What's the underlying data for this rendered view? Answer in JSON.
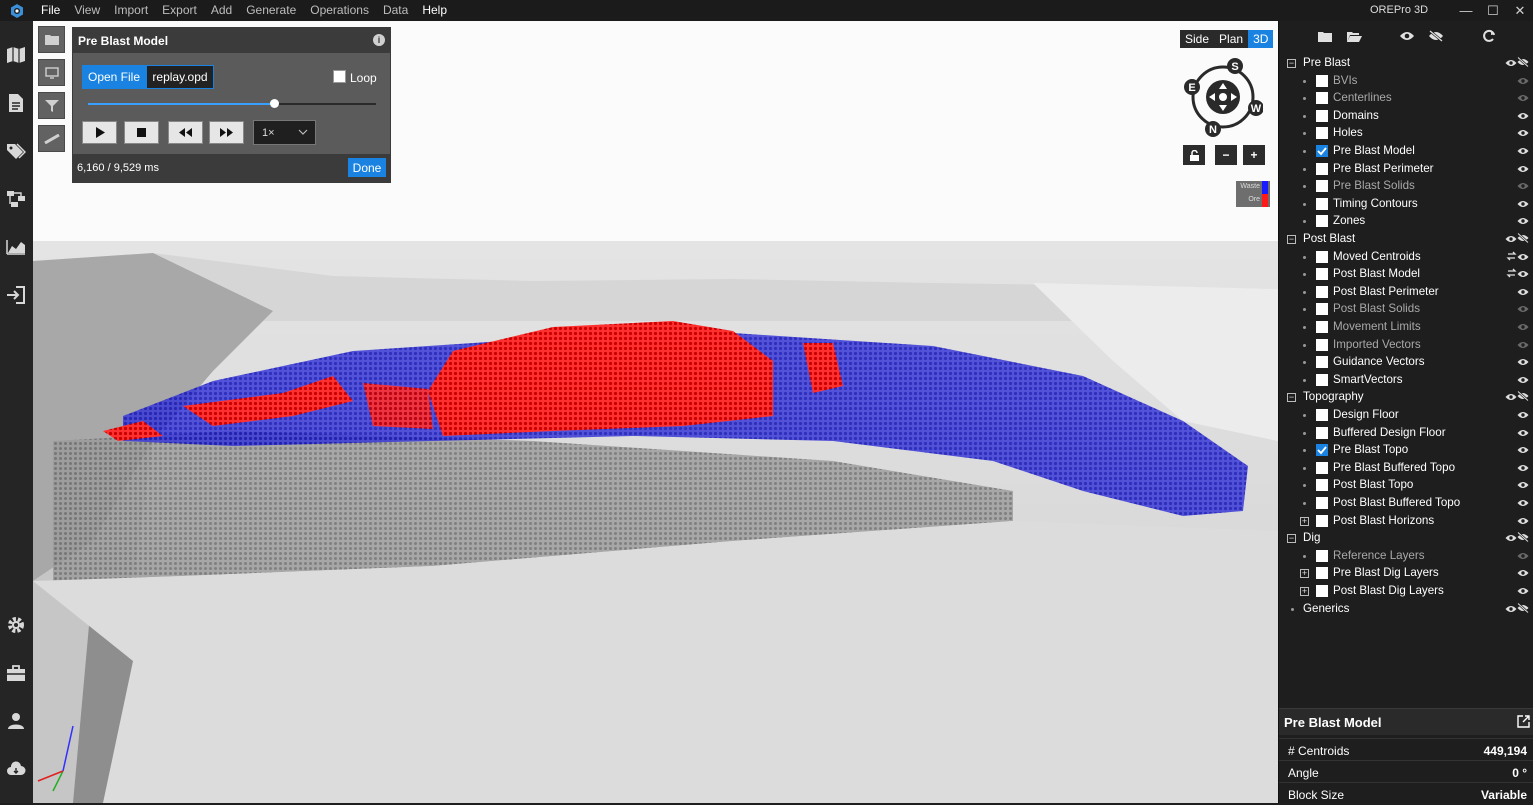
{
  "menu": [
    "File",
    "View",
    "Import",
    "Export",
    "Add",
    "Generate",
    "Operations",
    "Data",
    "Help"
  ],
  "app_title": "OREPro 3D",
  "left_rail_icons": [
    "map-icon",
    "document-icon",
    "tag-icon",
    "flow-icon",
    "chart-icon",
    "import-icon",
    "settings-icon",
    "toolbox-icon",
    "user-icon",
    "cloud-icon"
  ],
  "replay": {
    "title": "Pre Blast Model",
    "open_file_label": "Open File",
    "file_name": "replay.opd",
    "loop_label": "Loop",
    "loop_checked": false,
    "progress_fraction": 0.646,
    "speed": "1×",
    "time_readout": "6,160 / 9,529 ms",
    "done_label": "Done"
  },
  "view_toggle": {
    "options": [
      "Side",
      "Plan",
      "3D"
    ],
    "active": "3D"
  },
  "compass": {
    "labels": [
      "S",
      "E",
      "W",
      "N"
    ]
  },
  "legend": {
    "items": [
      {
        "label": "Waste",
        "color": "#1a1aff"
      },
      {
        "label": "Ore",
        "color": "#ff1a1a"
      }
    ]
  },
  "tree": [
    {
      "label": "Pre Blast",
      "level": 0,
      "expanded": true,
      "eye": "both"
    },
    {
      "label": "BVIs",
      "level": 1,
      "checked": false,
      "dim": true,
      "eye": "dim"
    },
    {
      "label": "Centerlines",
      "level": 1,
      "checked": false,
      "dim": true,
      "eye": "dim"
    },
    {
      "label": "Domains",
      "level": 1,
      "checked": false,
      "dim": false,
      "eye": "on"
    },
    {
      "label": "Holes",
      "level": 1,
      "checked": false,
      "dim": false,
      "eye": "on"
    },
    {
      "label": "Pre Blast Model",
      "level": 1,
      "checked": true,
      "dim": false,
      "eye": "on"
    },
    {
      "label": "Pre Blast Perimeter",
      "level": 1,
      "checked": false,
      "dim": false,
      "eye": "on"
    },
    {
      "label": "Pre Blast Solids",
      "level": 1,
      "checked": false,
      "dim": true,
      "eye": "dim"
    },
    {
      "label": "Timing Contours",
      "level": 1,
      "checked": false,
      "dim": false,
      "eye": "on"
    },
    {
      "label": "Zones",
      "level": 1,
      "checked": false,
      "dim": false,
      "eye": "on"
    },
    {
      "label": "Post Blast",
      "level": 0,
      "expanded": true,
      "eye": "both"
    },
    {
      "label": "Moved Centroids",
      "level": 1,
      "checked": false,
      "dim": false,
      "eye": "on",
      "extra": true
    },
    {
      "label": "Post Blast Model",
      "level": 1,
      "checked": false,
      "dim": false,
      "eye": "on",
      "extra": true
    },
    {
      "label": "Post Blast Perimeter",
      "level": 1,
      "checked": false,
      "dim": false,
      "eye": "on"
    },
    {
      "label": "Post Blast Solids",
      "level": 1,
      "checked": false,
      "dim": true,
      "eye": "dim"
    },
    {
      "label": "Movement Limits",
      "level": 1,
      "checked": false,
      "dim": true,
      "eye": "dim"
    },
    {
      "label": "Imported Vectors",
      "level": 1,
      "checked": false,
      "dim": true,
      "eye": "dim"
    },
    {
      "label": "Guidance Vectors",
      "level": 1,
      "checked": false,
      "dim": false,
      "eye": "on"
    },
    {
      "label": "SmartVectors",
      "level": 1,
      "checked": false,
      "dim": false,
      "eye": "on"
    },
    {
      "label": "Topography",
      "level": 0,
      "expanded": true,
      "eye": "both"
    },
    {
      "label": "Design Floor",
      "level": 1,
      "checked": false,
      "dim": false,
      "eye": "on"
    },
    {
      "label": "Buffered Design Floor",
      "level": 1,
      "checked": false,
      "dim": false,
      "eye": "on"
    },
    {
      "label": "Pre Blast Topo",
      "level": 1,
      "checked": true,
      "dim": false,
      "eye": "on"
    },
    {
      "label": "Pre Blast Buffered Topo",
      "level": 1,
      "checked": false,
      "dim": false,
      "eye": "on"
    },
    {
      "label": "Post Blast Topo",
      "level": 1,
      "checked": false,
      "dim": false,
      "eye": "on"
    },
    {
      "label": "Post Blast Buffered Topo",
      "level": 1,
      "checked": false,
      "dim": false,
      "eye": "on"
    },
    {
      "label": "Post Blast Horizons",
      "level": 1,
      "checked": false,
      "dim": false,
      "eye": "on",
      "expander": "+"
    },
    {
      "label": "Dig",
      "level": 0,
      "expanded": true,
      "eye": "both"
    },
    {
      "label": "Reference Layers",
      "level": 1,
      "checked": false,
      "dim": true,
      "eye": "dim"
    },
    {
      "label": "Pre Blast Dig Layers",
      "level": 1,
      "checked": false,
      "dim": false,
      "eye": "on",
      "expander": "+"
    },
    {
      "label": "Post Blast Dig Layers",
      "level": 1,
      "checked": false,
      "dim": false,
      "eye": "on",
      "expander": "+"
    },
    {
      "label": "Generics",
      "level": 0,
      "leaf": true,
      "eye": "both"
    }
  ],
  "info": {
    "title": "Pre Blast Model",
    "props": [
      {
        "key": "# Centroids",
        "value": "449,194"
      },
      {
        "key": "Angle",
        "value": "0 °"
      },
      {
        "key": "Block Size",
        "value": "Variable"
      }
    ]
  },
  "colors": {
    "accent": "#1a83e2",
    "ore": "#e01010",
    "waste": "#1a1ad0"
  }
}
